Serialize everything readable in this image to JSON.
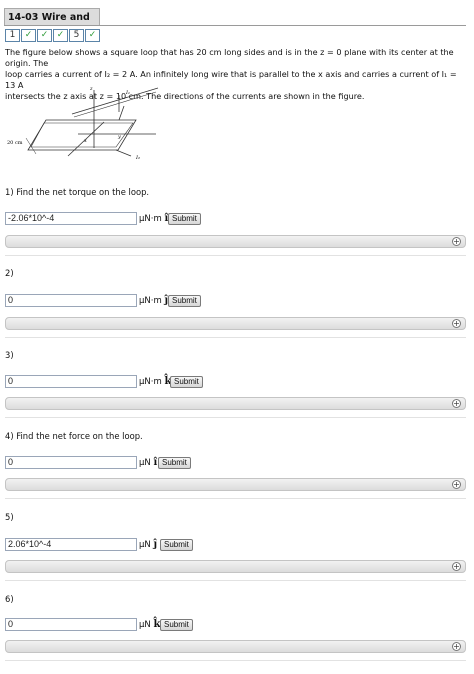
{
  "header": {
    "title": "14-03 Wire and Loop"
  },
  "steps": [
    "1",
    "✓",
    "✓",
    "✓",
    "5",
    "✓"
  ],
  "intro": {
    "line1": "The figure below shows a square loop that has 20 cm long sides and is in the z = 0 plane with its center at the origin. The",
    "line2": "loop carries a current of I₂ = 2 A. An infinitely long wire that is parallel to the x axis and carries a current of I₁ = 13 A",
    "line3": "intersects the z axis at z = 10 cm. The directions of the currents are shown in the figure."
  },
  "figure": {
    "side_label": "20 cm",
    "z": "z",
    "y": "y",
    "x": "x",
    "i1": "I₁",
    "i2": "I₂"
  },
  "questions": [
    {
      "prompt": "1) Find the net torque on the loop.",
      "value": "-2.06*10^-4",
      "unit": "μN·m",
      "vec": "î"
    },
    {
      "prompt": "2)",
      "value": "0",
      "unit": "μN·m",
      "vec": "ĵ"
    },
    {
      "prompt": "3)",
      "value": "0",
      "unit": "μN·m",
      "vec": "k̂"
    },
    {
      "prompt": "4) Find the net force on the loop.",
      "value": "0",
      "unit": "μN",
      "vec": "î"
    },
    {
      "prompt": "5)",
      "value": "2.06*10^-4",
      "unit": "μN",
      "vec": "ĵ"
    },
    {
      "prompt": "6)",
      "value": "0",
      "unit": "μN",
      "vec": "k̂"
    }
  ],
  "submit_label": "Submit",
  "hint_plus": "+"
}
